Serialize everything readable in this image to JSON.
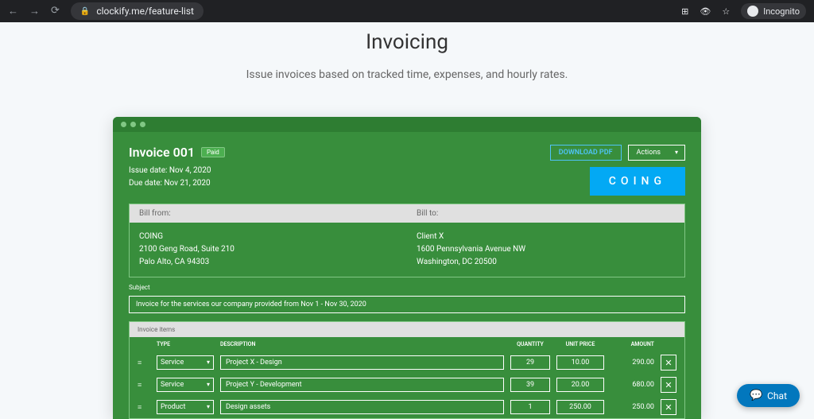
{
  "browser": {
    "url": "clockify.me/feature-list",
    "incognito_label": "Incognito"
  },
  "page": {
    "title": "Invoicing",
    "subtitle": "Issue invoices based on tracked time, expenses, and hourly rates."
  },
  "invoice": {
    "title": "Invoice 001",
    "badge": "Paid",
    "issue_date": "Issue date: Nov 4, 2020",
    "due_date": "Due date: Nov 21, 2020",
    "download_btn": "DOWNLOAD PDF",
    "actions_btn": "Actions",
    "logo": "COING",
    "bill_from_label": "Bill from:",
    "bill_to_label": "Bill to:",
    "from": {
      "name": "COING",
      "line1": "2100 Geng Road, Suite 210",
      "line2": "Palo Alto, CA 94303"
    },
    "to": {
      "name": "Client X",
      "line1": "1600 Pennsylvania Avenue NW",
      "line2": "Washington, DC 20500"
    },
    "subject_label": "Subject",
    "subject": "Invoice for the services our company provided from Nov 1 - Nov 30, 2020",
    "items_header": "Invoice items",
    "cols": {
      "type": "TYPE",
      "description": "DESCRIPTION",
      "quantity": "QUANTITY",
      "unit_price": "UNIT PRICE",
      "amount": "AMOUNT"
    },
    "items": [
      {
        "type": "Service",
        "desc": "Project X - Design",
        "qty": "29",
        "price": "10.00",
        "amount": "290.00"
      },
      {
        "type": "Service",
        "desc": "Project Y - Development",
        "qty": "39",
        "price": "20.00",
        "amount": "680.00"
      },
      {
        "type": "Product",
        "desc": "Design assets",
        "qty": "1",
        "price": "250.00",
        "amount": "250.00"
      }
    ]
  },
  "chat": {
    "label": "Chat"
  }
}
